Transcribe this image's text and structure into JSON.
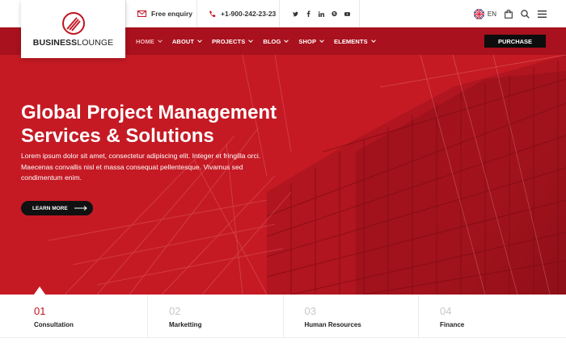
{
  "brand": {
    "name_bold": "BUSINESS",
    "name_light": "LOUNGE"
  },
  "topbar": {
    "enquiry": "Free enquiry",
    "phone": "+1-900-242-23-23",
    "social": [
      "twitter-icon",
      "facebook-icon",
      "linkedin-icon",
      "skype-icon",
      "youtube-icon"
    ],
    "language": "EN"
  },
  "nav": {
    "items": [
      {
        "label": "HOME"
      },
      {
        "label": "ABOUT"
      },
      {
        "label": "PROJECTS"
      },
      {
        "label": "BLOG"
      },
      {
        "label": "SHOP"
      },
      {
        "label": "ELEMENTS"
      }
    ],
    "purchase": "PURCHASE"
  },
  "hero": {
    "title_line1": "Global Project Management",
    "title_line2": "Services & Solutions",
    "description": "Lorem ipsum dolor sit amet, consectetur adipiscing elit. Integer et fringilla orci. Maecenas convallis nisl et massa consequat pellentesque. Vivamus sed condimentum enim.",
    "button": "LEARN MORE"
  },
  "tabs": [
    {
      "number": "01",
      "label": "Consultation"
    },
    {
      "number": "02",
      "label": "Marketting"
    },
    {
      "number": "03",
      "label": "Human Resources"
    },
    {
      "number": "04",
      "label": "Finance"
    }
  ],
  "colors": {
    "accent": "#c0131d",
    "nav": "#a8111d",
    "hero": "#c51a24",
    "dark": "#111111"
  }
}
